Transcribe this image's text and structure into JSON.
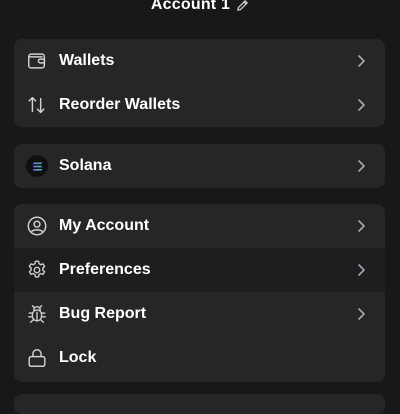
{
  "header": {
    "title": "Account 1"
  },
  "wallet_group": {
    "items": [
      {
        "label": "Wallets",
        "icon": "wallet-icon"
      },
      {
        "label": "Reorder Wallets",
        "icon": "reorder-icon"
      }
    ]
  },
  "network_group": {
    "items": [
      {
        "label": "Solana",
        "icon": "solana-icon"
      }
    ]
  },
  "settings_group": {
    "items": [
      {
        "label": "My Account",
        "icon": "user-icon"
      },
      {
        "label": "Preferences",
        "icon": "gear-icon"
      },
      {
        "label": "Bug Report",
        "icon": "bug-icon"
      },
      {
        "label": "Lock",
        "icon": "lock-icon"
      }
    ]
  },
  "colors": {
    "background": "#18181a",
    "panel": "#262628",
    "highlight_row": "#1e1e20",
    "text": "#ffffff",
    "icon": "#cfcfd2"
  }
}
